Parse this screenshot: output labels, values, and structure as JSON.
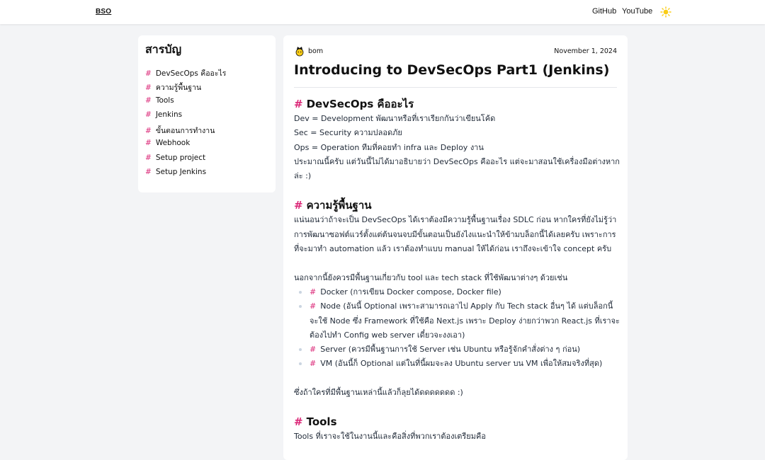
{
  "header": {
    "logo": "BSO",
    "nav": [
      "GitHub",
      "YouTube"
    ],
    "theme_icon": "sun-icon"
  },
  "toc": {
    "title": "สารบัญ",
    "items": [
      "DevSecOps คืออะไร",
      "ความรู้พื้นฐาน",
      "Tools",
      "Jenkins",
      "ขั้นตอนการทำงาน",
      "Webhook",
      "Setup project",
      "Setup Jenkins"
    ]
  },
  "post": {
    "author": "bom",
    "date": "November 1, 2024",
    "title": "Introducing to DevSecOps Part1 (Jenkins)",
    "hash": "#",
    "sections": {
      "s1": {
        "heading": "DevSecOps คืออะไร",
        "lines": [
          "Dev = Development พัฒนาหรือที่เราเรียกกันว่าเขียนโค้ด",
          "Sec = Security ความปลอดภัย",
          "Ops = Operation ทีมที่คอยทำ infra และ Deploy งาน",
          "ประมาณนี้ครับ แต่วันนี้ไม่ได้มาอธิบายว่า DevSecOps คืออะไร แต่จะมาสอนใช้เครื่องมือต่างหากล่ะ :)"
        ]
      },
      "s2": {
        "heading": "ความรู้พื้นฐาน",
        "intro": "แน่นอนว่าถ้าจะเป็น DevSecOps ได้เราต้องมีความรู้พื้นฐานเรื่อง SDLC ก่อน หากใครที่ยังไม่รู้ว่า การพัฒนาซอฟต์แวร์ตั้งแต่ต้นจนจบมีขั้นตอนเป็นยังไงแนะนำให้ข้ามบล็อกนี้ได้เลยครับ เพราะการที่จะมาทำ automation แล้ว เราต้องทำแบบ manual ให้ได้ก่อน เราถึงจะเข้าใจ concept ครับ",
        "lead": "นอกจากนี้ยังควรมีพื้นฐานเกี่ยวกับ tool และ tech stack ที่ใช้พัฒนาต่างๆ ด้วยเช่น",
        "bullets": [
          "Docker (การเขียน Docker compose, Docker file)",
          "Node (อันนี้ Optional เพราะสามารถเอาไป Apply กับ Tech stack อื่นๆ ได้ แต่บล็อกนี้จะใช้ Node ซึ่ง Framework ที่ใช้คือ Next.js เพราะ Deploy ง่ายกว่าพวก React.js ที่เราจะต้องไปทำ Config web server เดี๋ยวจะงงเอา)",
          "Server (ควรมีพื้นฐานการใช้ Server เช่น Ubuntu หรือรู้จักคำสั่งต่าง ๆ ก่อน)",
          "VM (อันนี้ก็ Optional แต่ในที่นี้ผมจะลง Ubuntu server บน VM เพื่อให้สมจริงที่สุด)"
        ],
        "outro": "ซึ่งถ้าใครที่มีพื้นฐานเหล่านี้แล้วก็ลุยได้ดดดดดดด :)"
      },
      "s3": {
        "heading": "Tools",
        "intro": "Tools ที่เราจะใช้ในงานนี้และคือสิ่งที่พวกเราต้องเตรียมคือ"
      }
    }
  },
  "colors": {
    "accent": "#db2777",
    "background": "#f3f4f6",
    "card": "#ffffff"
  }
}
